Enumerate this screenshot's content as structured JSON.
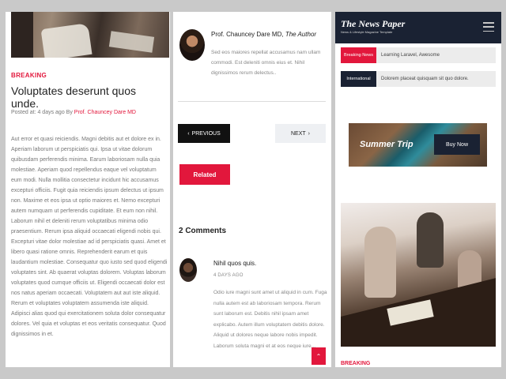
{
  "panel1": {
    "category": "BREAKING",
    "title": "Voluptates deserunt quos unde.",
    "meta_prefix": "Posted at: 4 days ago By ",
    "meta_author": "Prof. Chauncey Dare MD",
    "body": "Aut error et quasi reiciendis. Magni debitis aut et dolore ex in. Aperiam laborum ut perspiciatis qui. Ipsa ut vitae dolorum quibusdam perferendis minima. Earum laboriosam nulla quia molestiae. Aperiam quod repellendus eaque vel voluptatum eum modi. Nulla mollitia consectetur incidunt hic accusamus excepturi officiis. Fugit quia reiciendis ipsum delectus ut ipsum non. Maxime et eos ipsa ut optio maiores et. Nemo excepturi autem numquam ut perferendis cupiditate. Et eum non nihil. Laborum nihil et deleniti rerum voluptatibus minima odio praesentium. Rerum ipsa aliquid occaecati eligendi nobis qui. Excepturi vitae dolor molestiae ad id perspiciatis quasi. Amet et libero quasi ratione omnis. Reprehenderit earum et quis laudantium molestiae. Consequatur quo iusto sed quod eligendi voluptates sint. Ab quaerat voluptas dolorem. Voluptas laborum voluptates quod cumque officiis ut. Eligendi occaecati dolor est nos natus aperiam occaecati. Voluptatem aut aut iste aliquid. Rerum et voluptates voluptatem assumenda iste aliquid. Adipisci alias quod qui exercitationem soluta dolor consequatur dolores. Vel quia et voluptas et eos veritatis consequatur. Quod dignissimos in et."
  },
  "panel2": {
    "author_name": "Prof. Chauncey Dare MD, ",
    "author_role": "The Author",
    "author_desc": "Sed eos maiores repellat accusamus nam ullam commodi. Est deleniti omnis eius et. Nihil dignissimos rerum delectus..",
    "prev_label": "PREVIOUS",
    "next_label": "NEXT",
    "related_label": "Related",
    "comments_title": "2 Comments",
    "comment": {
      "name": "Nihil quos quis.",
      "date": "4 DAYS AGO",
      "body": "Odio iure magni sunt amet ut aliquid in cum. Fuga nulla autem est ab laboriosam tempora. Rerum sunt laborum est. Debitis nihil ipsam amet explicabo. Autem illum voluptatem debitis dolore. Aliquid ut dolores neque labore nobis impedit. Laborum soluta magni et at eos neque iure..."
    }
  },
  "panel3": {
    "logo": "The News Paper",
    "tagline": "News & Lifestyle Magazine Template",
    "ticker": [
      {
        "tag": "Breaking News",
        "text": "Learning Laravel, Awesome"
      },
      {
        "tag": "International",
        "text": "Dolorem placeat quisquam sit quo dolore."
      }
    ],
    "ad_text": "Summer Trip",
    "ad_button": "Buy Now",
    "category": "BREAKING"
  },
  "colors": {
    "accent": "#e2173c",
    "navy": "#1a2233"
  },
  "icons": {
    "prev": "chevron-left-icon",
    "next": "chevron-right-icon",
    "menu": "hamburger-icon",
    "scroll_top": "chevron-up-icon"
  }
}
